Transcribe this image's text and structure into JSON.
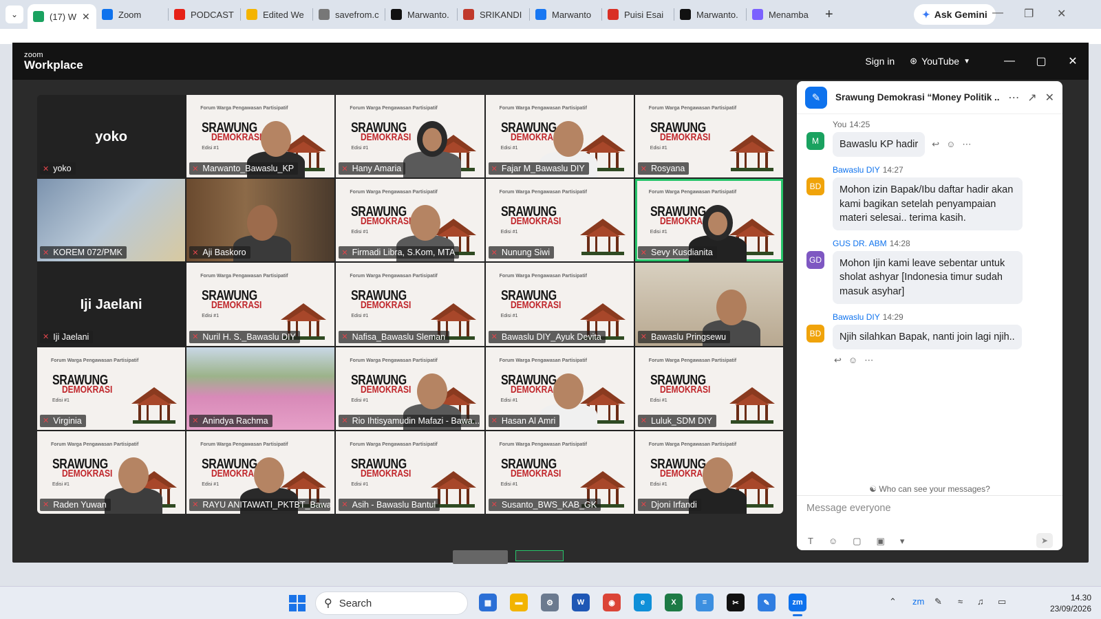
{
  "browser": {
    "tabs": [
      {
        "label": "(17) W",
        "icon": "gmail-count",
        "color": "#1aa260",
        "active": true
      },
      {
        "label": "Zoom",
        "icon": "zoom-logo",
        "color": "#0e72ed"
      },
      {
        "label": "PODCAST",
        "icon": "youtube-logo",
        "color": "#e62117"
      },
      {
        "label": "Edited We",
        "icon": "drive-logo",
        "color": "#f4b400"
      },
      {
        "label": "savefrom.c",
        "icon": "globe",
        "color": "#777777"
      },
      {
        "label": "Marwanto.",
        "icon": "capcut-logo",
        "color": "#111111"
      },
      {
        "label": "SRIKANDI",
        "icon": "srikandi-logo",
        "color": "#c0392b"
      },
      {
        "label": "Marwanto",
        "icon": "facebook-logo",
        "color": "#1877f2"
      },
      {
        "label": "Puisi Esai",
        "icon": "gmail-logo",
        "color": "#d93025"
      },
      {
        "label": "Marwanto.",
        "icon": "capcut-logo",
        "color": "#111111"
      },
      {
        "label": "Menamba",
        "icon": "gemini-star",
        "color": "#7b61ff"
      }
    ],
    "new_tab": "+",
    "gemini_label": "Ask Gemini"
  },
  "zoom": {
    "brand_small": "zoom",
    "brand_big": "Workplace",
    "sign_in": "Sign in",
    "youtube": "YouTube",
    "banner": {
      "head": "Forum Warga Pengawasan Partisipatif",
      "title1": "SRAWUNG",
      "title2": "DEMOKRASI",
      "edition": "Edisi #1"
    },
    "participants": [
      {
        "name": "yoko",
        "type": "name"
      },
      {
        "name": "Marwanto_Bawaslu_KP",
        "type": "person-banner"
      },
      {
        "name": "Hany Amaria",
        "type": "person-banner"
      },
      {
        "name": "Fajar M_Bawaslu DIY",
        "type": "person-banner"
      },
      {
        "name": "Rosyana",
        "type": "banner"
      },
      {
        "name": "KOREM 072/PMK",
        "type": "blur"
      },
      {
        "name": "Aji Baskoro",
        "type": "room"
      },
      {
        "name": "Firmadi Libra, S.Kom, MTA",
        "type": "person-banner"
      },
      {
        "name": "Nunung Siwi",
        "type": "banner"
      },
      {
        "name": "Sevy Kusdianita",
        "type": "person-banner",
        "speaking": true
      },
      {
        "name": "Iji Jaelani",
        "type": "name"
      },
      {
        "name": "Nuril H. S._Bawaslu DIY",
        "type": "banner"
      },
      {
        "name": "Nafisa_Bawaslu Sleman",
        "type": "banner"
      },
      {
        "name": "Bawaslu DIY_Ayuk Devita",
        "type": "banner"
      },
      {
        "name": "Bawaslu Pringsewu",
        "type": "office"
      },
      {
        "name": "Virginia",
        "type": "banner"
      },
      {
        "name": "Anindya Rachma",
        "type": "flowers"
      },
      {
        "name": "Rio Ihtisyamudin Mafazi - Bawa...",
        "type": "person-banner"
      },
      {
        "name": "Hasan Al Amri",
        "type": "person-banner"
      },
      {
        "name": "Luluk_SDM DIY",
        "type": "banner"
      },
      {
        "name": "Raden Yuwan",
        "type": "person-banner"
      },
      {
        "name": "RAYU ANITAWATI_PKTBT_Bawa...",
        "type": "person-banner"
      },
      {
        "name": "Asih - Bawaslu Bantul",
        "type": "banner"
      },
      {
        "name": "Susanto_BWS_KAB_GK",
        "type": "banner"
      },
      {
        "name": "Djoni Irfandi",
        "type": "person-banner"
      }
    ],
    "chat": {
      "title": "Srawung Demokrasi “Money Politik ...",
      "messages": [
        {
          "sender": "You",
          "time": "14:25",
          "avatar": "M",
          "avatar_color": "#1aa260",
          "text": "Bawaslu KP hadir",
          "me": true
        },
        {
          "sender": "Bawaslu DIY",
          "time": "14:27",
          "avatar": "BD",
          "avatar_color": "#f0a30a",
          "text": "Mohon izin Bapak/Ibu daftar hadir akan kami bagikan setelah penyampaian materi selesai.. terima kasih."
        },
        {
          "sender": "GUS DR. ABM",
          "time": "14:28",
          "avatar": "GD",
          "avatar_color": "#7e57c2",
          "text": "Mohon Ijin kami leave sebentar untuk sholat ashyar [Indonesia timur sudah masuk asyhar]"
        },
        {
          "sender": "Bawaslu DIY",
          "time": "14:29",
          "avatar": "BD",
          "avatar_color": "#f0a30a",
          "text": "Njih silahkan Bapak, nanti join lagi njih.."
        }
      ],
      "who_can_see": "Who can see your messages?",
      "placeholder": "Message everyone"
    }
  },
  "taskbar": {
    "search": "Search",
    "time": "14.30",
    "date": "23/09/2026",
    "apps": [
      {
        "name": "store",
        "color": "#2b6fd6",
        "glyph": "▦"
      },
      {
        "name": "file-explorer",
        "color": "#f2b400",
        "glyph": "▬"
      },
      {
        "name": "settings",
        "color": "#6b7a8f",
        "glyph": "⚙"
      },
      {
        "name": "word",
        "color": "#1f57b5",
        "glyph": "W"
      },
      {
        "name": "chrome",
        "color": "#db4437",
        "glyph": "◉"
      },
      {
        "name": "edge",
        "color": "#0f8fd8",
        "glyph": "e"
      },
      {
        "name": "excel",
        "color": "#1d7a45",
        "glyph": "X"
      },
      {
        "name": "notepad",
        "color": "#3c8fe0",
        "glyph": "≡"
      },
      {
        "name": "capcut",
        "color": "#111111",
        "glyph": "✂"
      },
      {
        "name": "paint",
        "color": "#2f7de1",
        "glyph": "✎"
      },
      {
        "name": "zoom",
        "color": "#0e72ed",
        "glyph": "zm",
        "active": true
      }
    ]
  }
}
